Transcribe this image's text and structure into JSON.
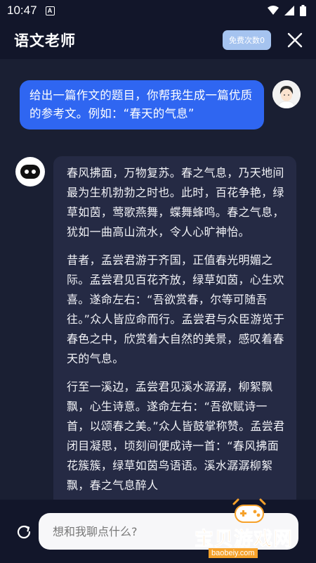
{
  "status_bar": {
    "time": "10:47",
    "notification_glyph": "A",
    "icons": [
      "wifi-icon",
      "signal-icon",
      "battery-icon"
    ]
  },
  "header": {
    "title": "语文老师",
    "free_badge": "免费次数0",
    "close_icon": "close-icon"
  },
  "chat": {
    "user_message": "给出一篇作文的题目，你帮我生成一篇优质的参考文。例如：“春天的气息”",
    "bot_paragraphs": [
      "春风拂面，万物复苏。春之气息，乃天地间最为生机勃勃之时也。此时，百花争艳，绿草如茵，莺歌燕舞，蝶舞蜂鸣。春之气息，犹如一曲高山流水，令人心旷神怡。",
      "昔者，孟尝君游于齐国，正值春光明媚之际。孟尝君见百花齐放，绿草如茵，心生欢喜。遂命左右：“吾欲赏春，尔等可随吾往。”众人皆应命而行。孟尝君与众臣游览于春色之中，欣赏着大自然的美景，感叹着春天的气息。",
      "行至一溪边，孟尝君见溪水潺潺，柳絮飘飘，心生诗意。遂命左右：“吾欲赋诗一首，以颂春之美。”众人皆鼓掌称赞。孟尝君闭目凝思，顷刻间便成诗一首：“春风拂面花簇簇，绿草如茵鸟语语。溪水潺潺柳絮飘，春之气息醉人"
    ]
  },
  "input": {
    "placeholder": "想和我聊点什么?",
    "refresh_icon": "refresh-icon"
  },
  "watermark": {
    "text": "宝贝游戏网",
    "url": "baobeiy.com"
  },
  "colors": {
    "background": "#1a1f33",
    "header": "#12162a",
    "user_bubble": "#2f66f1",
    "bot_bubble": "#252a44",
    "badge": "#a5c3ef",
    "watermark": "#f6a12a"
  }
}
